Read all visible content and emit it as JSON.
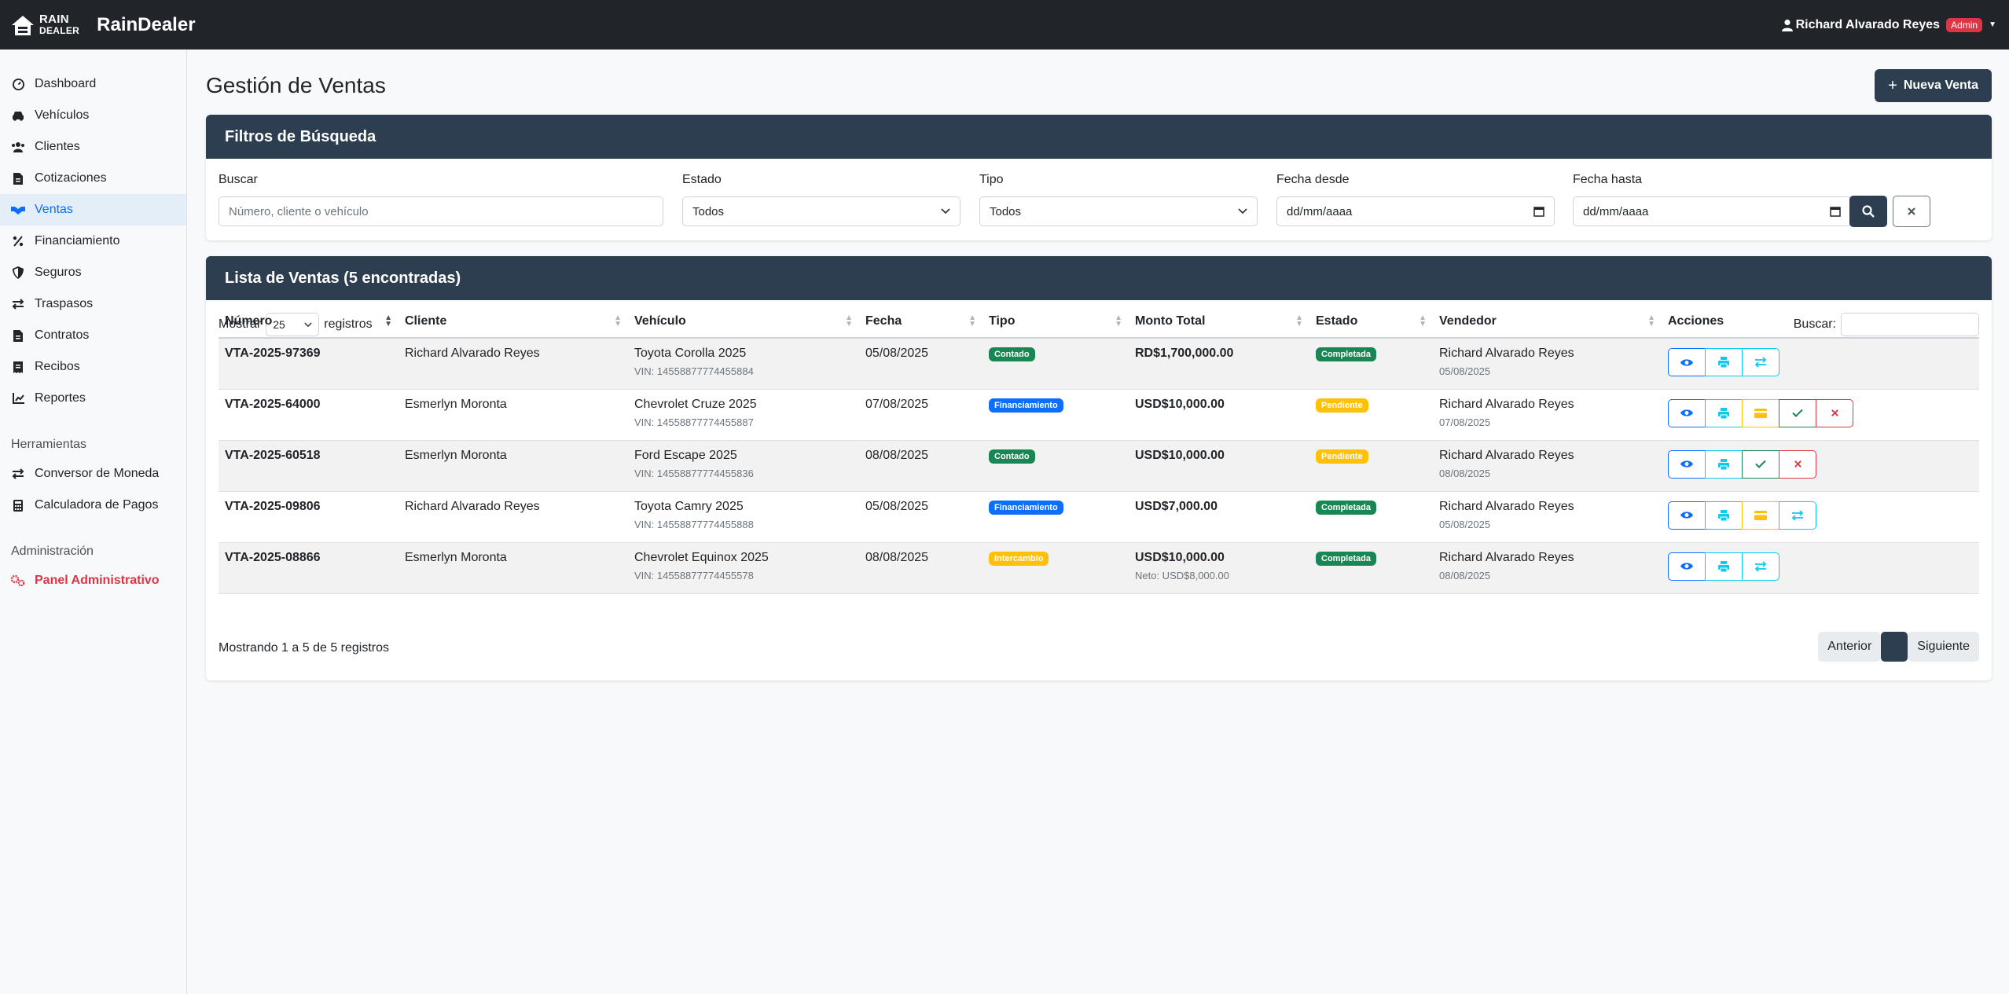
{
  "app": {
    "logo_line1": "RAIN",
    "logo_line2": "DEALER",
    "brand": "RainDealer",
    "user_name": "Richard Alvarado Reyes",
    "user_role": "Admin"
  },
  "sidebar": {
    "items": [
      {
        "label": "Dashboard",
        "icon": "dashboard-icon"
      },
      {
        "label": "Vehículos",
        "icon": "car-icon"
      },
      {
        "label": "Clientes",
        "icon": "users-icon"
      },
      {
        "label": "Cotizaciones",
        "icon": "document-icon"
      },
      {
        "label": "Ventas",
        "icon": "handshake-icon"
      },
      {
        "label": "Financiamiento",
        "icon": "percent-icon"
      },
      {
        "label": "Seguros",
        "icon": "shield-icon"
      },
      {
        "label": "Traspasos",
        "icon": "exchange-icon"
      },
      {
        "label": "Contratos",
        "icon": "contract-icon"
      },
      {
        "label": "Recibos",
        "icon": "receipt-icon"
      },
      {
        "label": "Reportes",
        "icon": "chart-icon"
      }
    ],
    "tools_label": "Herramientas",
    "tools": [
      {
        "label": "Conversor de Moneda",
        "icon": "exchange-icon"
      },
      {
        "label": "Calculadora de Pagos",
        "icon": "calculator-icon"
      }
    ],
    "admin_label": "Administración",
    "admin_item": "Panel Administrativo"
  },
  "page": {
    "title": "Gestión de Ventas",
    "new_button": "Nueva Venta"
  },
  "filters": {
    "header": "Filtros de Búsqueda",
    "search_label": "Buscar",
    "search_placeholder": "Número, cliente o vehículo",
    "estado_label": "Estado",
    "estado_value": "Todos",
    "tipo_label": "Tipo",
    "tipo_value": "Todos",
    "desde_label": "Fecha desde",
    "desde_value": "dd/mm/aaaa",
    "hasta_label": "Fecha hasta",
    "hasta_value": "dd/mm/aaaa"
  },
  "list": {
    "header": "Lista de Ventas (5 encontradas)",
    "show_label": "Mostrar",
    "length_value": "25",
    "records_label": "registros",
    "search_label": "Buscar:",
    "columns": [
      "Número",
      "Cliente",
      "Vehículo",
      "Fecha",
      "Tipo",
      "Monto Total",
      "Estado",
      "Vendedor",
      "Acciones"
    ],
    "rows": [
      {
        "numero": "VTA-2025-97369",
        "cliente": "Richard Alvarado Reyes",
        "vehiculo": "Toyota Corolla 2025",
        "vin": "VIN: 14558877774455884",
        "fecha": "05/08/2025",
        "tipo": "Contado",
        "monto": "RD$1,700,000.00",
        "neto": "",
        "estado": "Completada",
        "vendedor": "Richard Alvarado Reyes",
        "vfecha": "05/08/2025"
      },
      {
        "numero": "VTA-2025-64000",
        "cliente": "Esmerlyn Moronta",
        "vehiculo": "Chevrolet Cruze 2025",
        "vin": "VIN: 14558877774455887",
        "fecha": "07/08/2025",
        "tipo": "Financiamiento",
        "monto": "USD$10,000.00",
        "neto": "",
        "estado": "Pendiente",
        "vendedor": "Richard Alvarado Reyes",
        "vfecha": "07/08/2025"
      },
      {
        "numero": "VTA-2025-60518",
        "cliente": "Esmerlyn Moronta",
        "vehiculo": "Ford Escape 2025",
        "vin": "VIN: 14558877774455836",
        "fecha": "08/08/2025",
        "tipo": "Contado",
        "monto": "USD$10,000.00",
        "neto": "",
        "estado": "Pendiente",
        "vendedor": "Richard Alvarado Reyes",
        "vfecha": "08/08/2025"
      },
      {
        "numero": "VTA-2025-09806",
        "cliente": "Richard Alvarado Reyes",
        "vehiculo": "Toyota Camry 2025",
        "vin": "VIN: 14558877774455888",
        "fecha": "05/08/2025",
        "tipo": "Financiamiento",
        "monto": "USD$7,000.00",
        "neto": "",
        "estado": "Completada",
        "vendedor": "Richard Alvarado Reyes",
        "vfecha": "05/08/2025"
      },
      {
        "numero": "VTA-2025-08866",
        "cliente": "Esmerlyn Moronta",
        "vehiculo": "Chevrolet Equinox 2025",
        "vin": "VIN: 14558877774455578",
        "fecha": "08/08/2025",
        "tipo": "Intercambio",
        "monto": "USD$10,000.00",
        "neto": "Neto: USD$8,000.00",
        "estado": "Completada",
        "vendedor": "Richard Alvarado Reyes",
        "vfecha": "08/08/2025"
      }
    ],
    "info": "Mostrando 1 a 5 de 5 registros",
    "prev": "Anterior",
    "next": "Siguiente"
  },
  "colors": {
    "navbar": "#212529",
    "header": "#2c3e50",
    "accent": "#0d6efd",
    "success": "#198754",
    "warning": "#ffc107",
    "danger": "#dc3545"
  }
}
